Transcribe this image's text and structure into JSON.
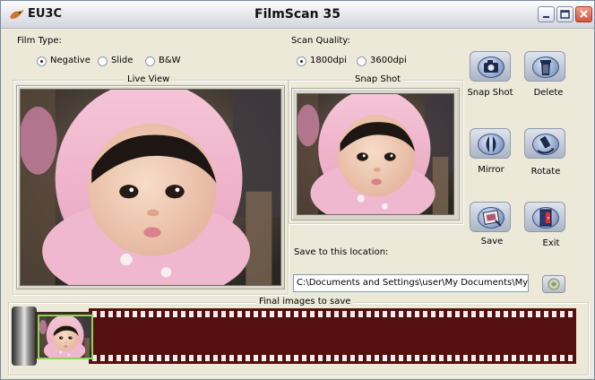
{
  "titlebar": {
    "app_name": "EU3C",
    "title": "FilmScan 35"
  },
  "film_type": {
    "label": "Film Type:",
    "options": [
      "Negative",
      "Slide",
      "B&W"
    ],
    "selected": "Negative"
  },
  "scan_quality": {
    "label": "Scan Quality:",
    "options": [
      "1800dpi",
      "3600dpi"
    ],
    "selected": "1800dpi"
  },
  "live_view": {
    "label": "Live  View"
  },
  "snap_shot_panel": {
    "label": "Snap Shot"
  },
  "actions": {
    "snap_shot": "Snap Shot",
    "delete": "Delete",
    "mirror": "Mirror",
    "rotate": "Rotate",
    "save": "Save",
    "exit": "Exit"
  },
  "save_location": {
    "label": "Save to this location:",
    "path": "C:\\Documents and Settings\\user\\My Documents\\My Pictur"
  },
  "final_images": {
    "label": "Final images to save"
  },
  "colors": {
    "film_strip": "#550f0f",
    "thumb_border": "#8ad458",
    "window_bg": "#ece9d8"
  }
}
